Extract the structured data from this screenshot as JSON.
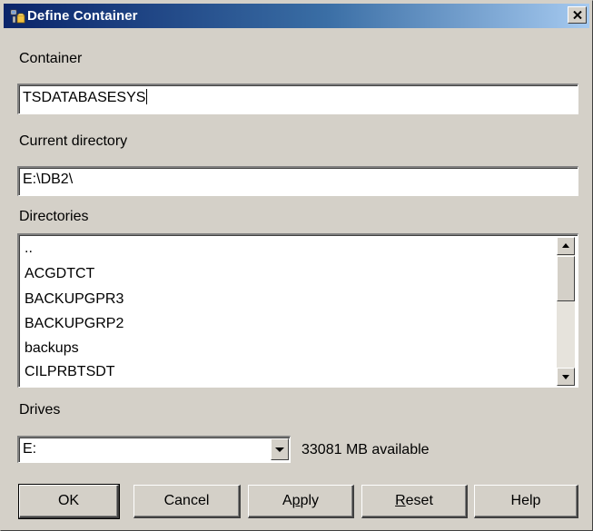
{
  "window": {
    "title": "Define Container",
    "icon": "db2-container-icon"
  },
  "container": {
    "label": "Container",
    "value": "TSDATABASESYS"
  },
  "current_directory": {
    "label": "Current directory",
    "value": "E:\\DB2\\"
  },
  "directories": {
    "label": "Directories",
    "items": [
      "..",
      "ACGDTCT",
      "BACKUPGPR3",
      "BACKUPGRP2",
      "backups",
      "CILPRBTSDT"
    ]
  },
  "drives": {
    "label": "Drives",
    "selected": "E:",
    "available_text": "33081 MB available"
  },
  "buttons": {
    "ok": "OK",
    "cancel": "Cancel",
    "apply_pre": "A",
    "apply_mn": "p",
    "apply_post": "ply",
    "reset_mn": "R",
    "reset_post": "eset",
    "help": "Help"
  },
  "colors": {
    "titlebar_start": "#0a246a",
    "titlebar_end": "#a6caf0",
    "face": "#d4d0c8"
  }
}
